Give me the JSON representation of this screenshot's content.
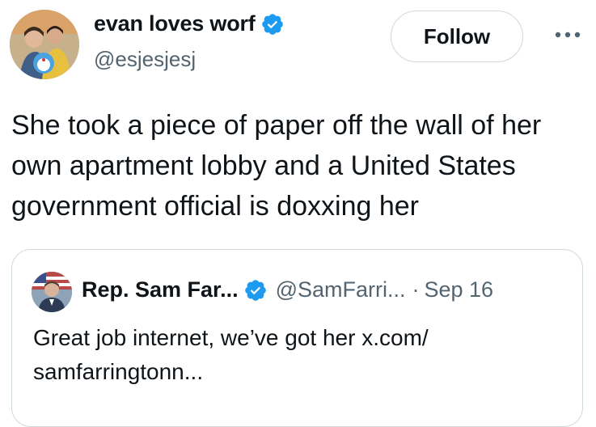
{
  "author": {
    "display_name": "evan loves worf",
    "handle": "@esjesjesj",
    "verified": true,
    "avatar_icon": "user-avatar-photo"
  },
  "actions": {
    "follow_label": "Follow",
    "more_icon": "more-horizontal-icon"
  },
  "tweet": {
    "text": "She took a piece of paper off the wall of her own apartment lobby and a United States government official is doxxing her"
  },
  "quoted": {
    "display_name": "Rep. Sam Far...",
    "handle": "@SamFarri...",
    "separator": "·",
    "date": "Sep 16",
    "verified": true,
    "text": "Great job internet, we’ve got her  x.com/ samfarringtonn..."
  },
  "colors": {
    "text_primary": "#0f1419",
    "text_secondary": "#536471",
    "verified_blue": "#1d9bf0",
    "border": "#cfd9de"
  }
}
